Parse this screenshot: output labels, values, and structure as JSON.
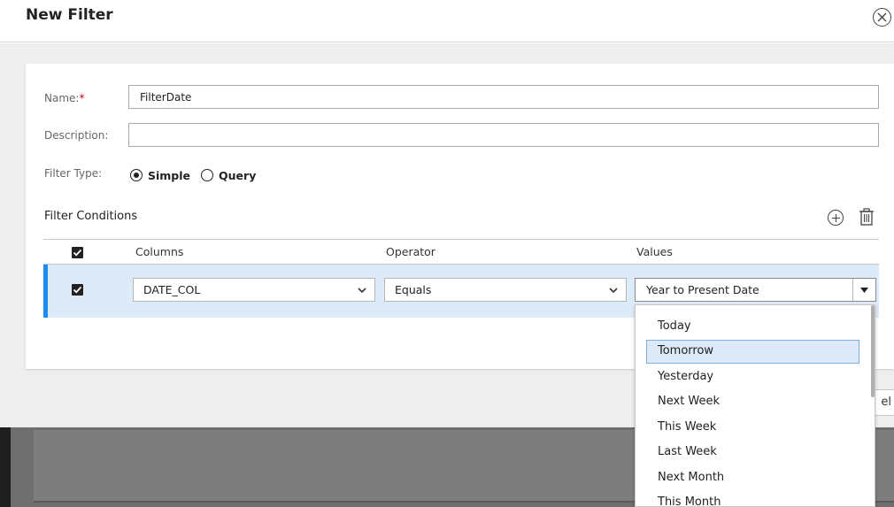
{
  "dialog": {
    "title": "New Filter"
  },
  "form": {
    "name_label": "Name:",
    "name_required_mark": "*",
    "name_value": "FilterDate",
    "description_label": "Description:",
    "description_value": "",
    "filter_type_label": "Filter Type:",
    "filter_type_options": [
      "Simple",
      "Query"
    ],
    "filter_type_selected": "Simple"
  },
  "conditions": {
    "title": "Filter Conditions",
    "headers": {
      "columns": "Columns",
      "operator": "Operator",
      "values": "Values"
    },
    "row": {
      "checked": true,
      "column": "DATE_COL",
      "operator": "Equals",
      "value": "Year to Present Date"
    }
  },
  "dropdown": {
    "items": [
      "Today",
      "Tomorrow",
      "Yesterday",
      "Next Week",
      "This Week",
      "Last Week",
      "Next Month",
      "This Month"
    ],
    "highlighted": "Tomorrow"
  },
  "footer": {
    "cancel_partial_label": "el"
  },
  "colors": {
    "accent": "#1d8ef0",
    "row_highlight": "#ddeaf8",
    "required": "#d0021b"
  },
  "icons": {
    "close": "close-icon",
    "add": "plus-circle-icon",
    "delete": "trash-icon",
    "dropdown": "chevron-down-icon",
    "checkbox": "checkmark-icon"
  }
}
